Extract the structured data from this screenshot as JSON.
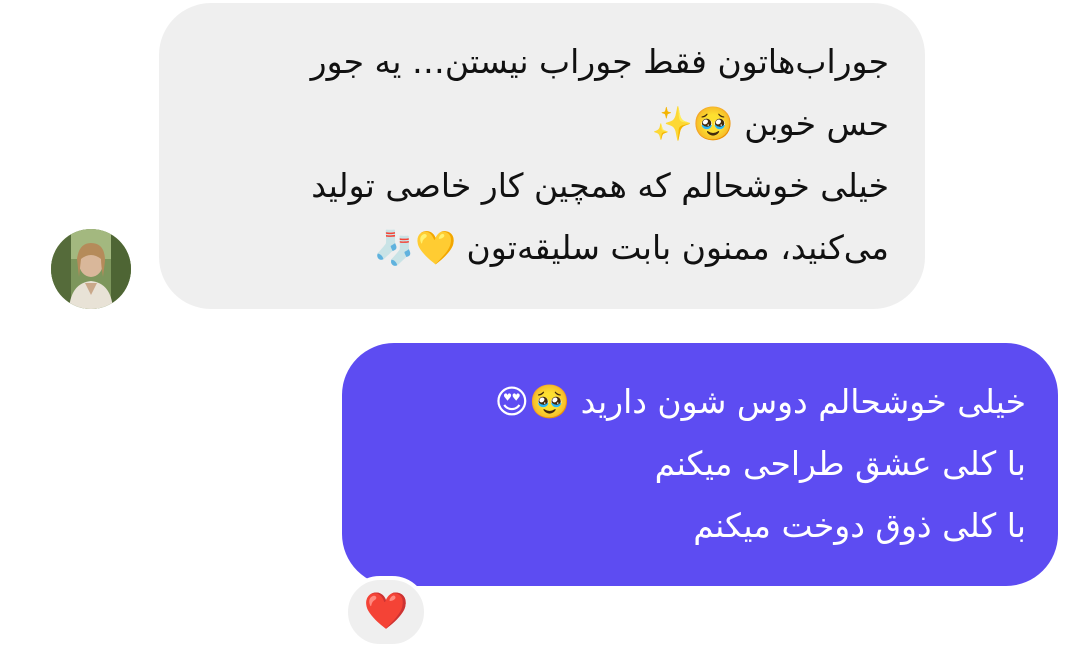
{
  "conversation": {
    "incoming": {
      "lines": [
        "جوراب‌هاتون فقط جوراب نیستن… یه جور",
        "حس خوبن 🥹✨",
        "خیلی خوشحالم که همچین کار خاصی تولید",
        "می‌کنید، ممنون بابت سلیقه‌تون 💛🧦"
      ]
    },
    "outgoing": {
      "lines": [
        "خیلی خوشحالم دوس شون دارید 🥹😍",
        "با کلی عشق طراحی میکنم",
        "با کلی ذوق دوخت میکنم"
      ],
      "reaction": "❤️"
    }
  },
  "colors": {
    "incoming_bubble": "#efefef",
    "outgoing_bubble": "#5d4cf2",
    "outgoing_text": "#ffffff"
  },
  "icons": {
    "avatar": "sender-avatar",
    "reaction": "heart-icon"
  }
}
